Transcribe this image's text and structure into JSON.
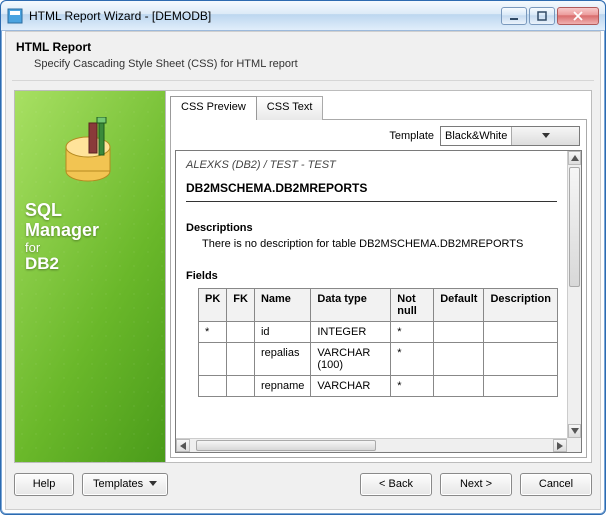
{
  "window": {
    "title": "HTML Report Wizard - [DEMODB]"
  },
  "header": {
    "title": "HTML Report",
    "subtitle": "Specify Cascading Style Sheet (CSS) for HTML report"
  },
  "sidebar": {
    "line1": "SQL",
    "line2": "Manager",
    "line3": "for",
    "line4": "DB2"
  },
  "tabs": {
    "preview": "CSS Preview",
    "text": "CSS Text"
  },
  "template": {
    "label": "Template",
    "value": "Black&White"
  },
  "preview": {
    "breadcrumb": "ALEXKS (DB2) / TEST - TEST",
    "table_name": "DB2MSCHEMA.DB2MREPORTS",
    "descriptions_heading": "Descriptions",
    "descriptions_text": "There is no description for table DB2MSCHEMA.DB2MREPORTS",
    "fields_heading": "Fields",
    "columns": {
      "pk": "PK",
      "fk": "FK",
      "name": "Name",
      "dtype": "Data type",
      "notnull": "Not null",
      "default": "Default",
      "desc": "Description"
    },
    "rows": [
      {
        "pk": "*",
        "fk": "",
        "name": "id",
        "dtype": "INTEGER",
        "notnull": "*",
        "default": "",
        "desc": ""
      },
      {
        "pk": "",
        "fk": "",
        "name": "repalias",
        "dtype": "VARCHAR (100)",
        "notnull": "*",
        "default": "",
        "desc": ""
      },
      {
        "pk": "",
        "fk": "",
        "name": "repname",
        "dtype": "VARCHAR",
        "notnull": "*",
        "default": "",
        "desc": ""
      }
    ]
  },
  "footer": {
    "help": "Help",
    "templates": "Templates",
    "back": "< Back",
    "next": "Next >",
    "cancel": "Cancel"
  }
}
